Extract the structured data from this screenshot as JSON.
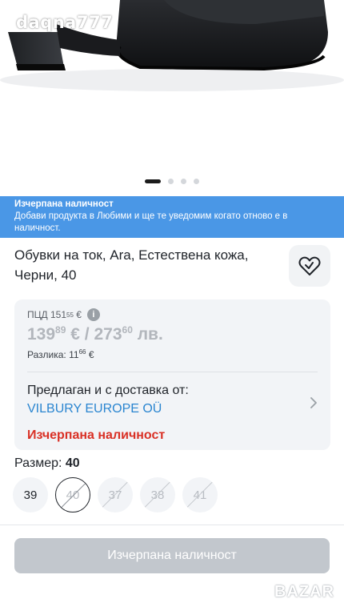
{
  "watermark": "daqna777",
  "gallery": {
    "slides": 4,
    "active": 0
  },
  "banner": {
    "title": "Изчерпана наличност",
    "text": "Добави продукта в Любими и ще те уведомим когато отново е в наличност."
  },
  "product": {
    "title": "Обувки на ток, Ara, Естествена кожа, Черни, 40"
  },
  "price": {
    "pcd_label": "ПЦД",
    "pcd_int": "151",
    "pcd_dec": "55",
    "pcd_cur": "€",
    "eur_int": "139",
    "eur_dec": "89",
    "eur_cur": "€",
    "sep": "/",
    "bgn_int": "273",
    "bgn_dec": "60",
    "bgn_cur": "лв.",
    "diff_label": "Разлика:",
    "diff_int": "11",
    "diff_dec": "66",
    "diff_cur": "€"
  },
  "seller": {
    "label": "Предлаган и с доставка от:",
    "name": "VILBURY EUROPE OÜ"
  },
  "stock_status": "Изчерпана наличност",
  "size": {
    "label": "Размер:",
    "selected": "40",
    "options": [
      "39",
      "40",
      "37",
      "38",
      "41"
    ]
  },
  "cta_label": "Изчерпана наличност",
  "brand_watermark": "BAZAR",
  "colors": {
    "banner": "#4a97e6",
    "link": "#2a85d0",
    "stock_red": "#d93025",
    "cta_disabled": "#c2c7cd"
  }
}
